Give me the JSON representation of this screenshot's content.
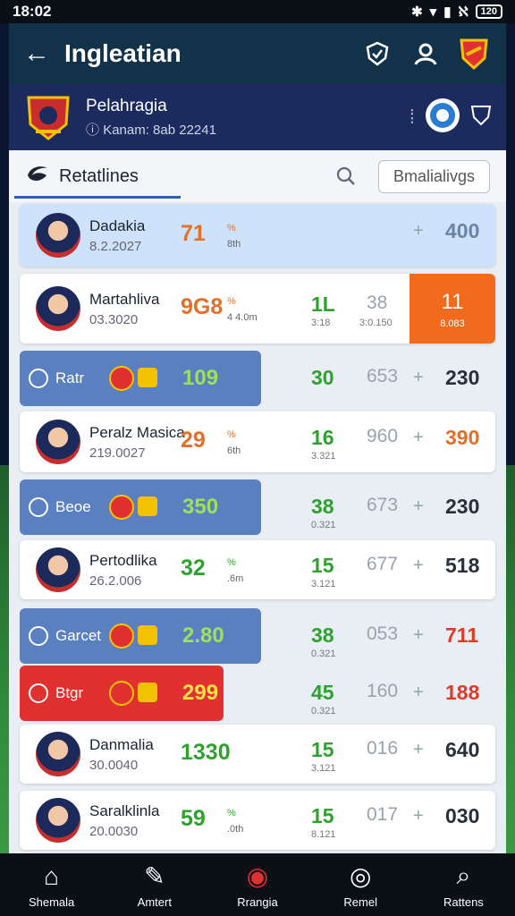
{
  "status_bar": {
    "time": "18:02",
    "battery": "120"
  },
  "header": {
    "title": "Ingleatian"
  },
  "club": {
    "name": "Pelahragia",
    "sub": "Kanam: 8ab 22241"
  },
  "tabs": {
    "active_label": "Retatlines",
    "filter_label": "Bmalialivgs"
  },
  "rows": [
    {
      "kind": "card",
      "highlight": "#cfe2fb",
      "name": "Dadakia",
      "date": "8.2.2027",
      "pct": "71",
      "pct_unit": "%",
      "pct_sub": "8th",
      "pct_color": "#e0702a",
      "plus": "+",
      "end": "400",
      "end_color": "#6a84a8"
    },
    {
      "kind": "card",
      "highlight": "#fff",
      "name": "Martahliva",
      "date": "03.3020",
      "pct": "9G8",
      "pct_unit": "%",
      "pct_sub": "4 4.0m",
      "pct_color": "#e0702a",
      "green": "1L",
      "green_sub": "3:18",
      "gray": "38",
      "gray_sub": "3:0.150",
      "badge": "11",
      "badge_sub": "8.083"
    },
    {
      "kind": "tag",
      "tag_color": "#5b80c0",
      "tag_label": "Ratr",
      "tag_val": "109",
      "green": "30",
      "gray": "653",
      "plus": "+",
      "end": "230",
      "end_color": "#2a2f3a"
    },
    {
      "kind": "card",
      "highlight": "#fff",
      "name": "Peralz Masica",
      "date": "219.0027",
      "pct": "29",
      "pct_unit": "%",
      "pct_sub": "6th",
      "pct_color": "#e0702a",
      "green": "16",
      "green_sub": "3.321",
      "gray": "960",
      "plus": "+",
      "end": "390",
      "end_color": "#e0702a"
    },
    {
      "kind": "tag",
      "tag_color": "#5b80c0",
      "tag_label": "Beoe",
      "tag_val": "350",
      "green": "38",
      "green_sub": "0.321",
      "gray": "673",
      "plus": "+",
      "end": "230",
      "end_color": "#2a2f3a"
    },
    {
      "kind": "card",
      "highlight": "#fff",
      "name": "Pertodlika",
      "date": "26.2.006",
      "pct": "32",
      "pct_unit": "%",
      "pct_sub": ".6m",
      "pct_color": "#2fa12f",
      "green": "15",
      "green_sub": "3.121",
      "gray": "677",
      "plus": "+",
      "end": "518",
      "end_color": "#2a2f3a"
    },
    {
      "kind": "tag",
      "tag_color": "#5b80c0",
      "tag_label": "Garcet",
      "tag_val": "2.80",
      "green": "38",
      "green_sub": "0.321",
      "gray": "053",
      "plus": "+",
      "end": "711",
      "end_color": "#e03a2a"
    },
    {
      "kind": "tag",
      "tag_color": "#e0302f",
      "tag_label": "Btgr",
      "tag_val": "299",
      "tag_val_color": "#ffe14a",
      "green": "45",
      "green_sub": "0.321",
      "gray": "160",
      "plus": "+",
      "end": "188",
      "end_color": "#e03a2a"
    },
    {
      "kind": "card",
      "highlight": "#fff",
      "name": "Danmalia",
      "date": "30.0040",
      "pct": "1330",
      "pct_unit": "",
      "pct_sub": "",
      "pct_color": "#2fa12f",
      "green": "15",
      "green_sub": "3.121",
      "gray": "016",
      "plus": "+",
      "end": "640",
      "end_color": "#2a2f3a"
    },
    {
      "kind": "card",
      "highlight": "#fff",
      "name": "Saralklinla",
      "date": "20.0030",
      "pct": "59",
      "pct_unit": "%",
      "pct_sub": ".0th",
      "pct_color": "#2fa12f",
      "green": "15",
      "green_sub": "8.121",
      "gray": "017",
      "plus": "+",
      "end": "030",
      "end_color": "#2a2f3a"
    }
  ],
  "nav": [
    {
      "label": "Shemala",
      "icon": "home-icon"
    },
    {
      "label": "Amtert",
      "icon": "pencil-icon"
    },
    {
      "label": "Rrangia",
      "icon": "target-icon"
    },
    {
      "label": "Remel",
      "icon": "ball-icon"
    },
    {
      "label": "Rattens",
      "icon": "search-icon"
    }
  ]
}
